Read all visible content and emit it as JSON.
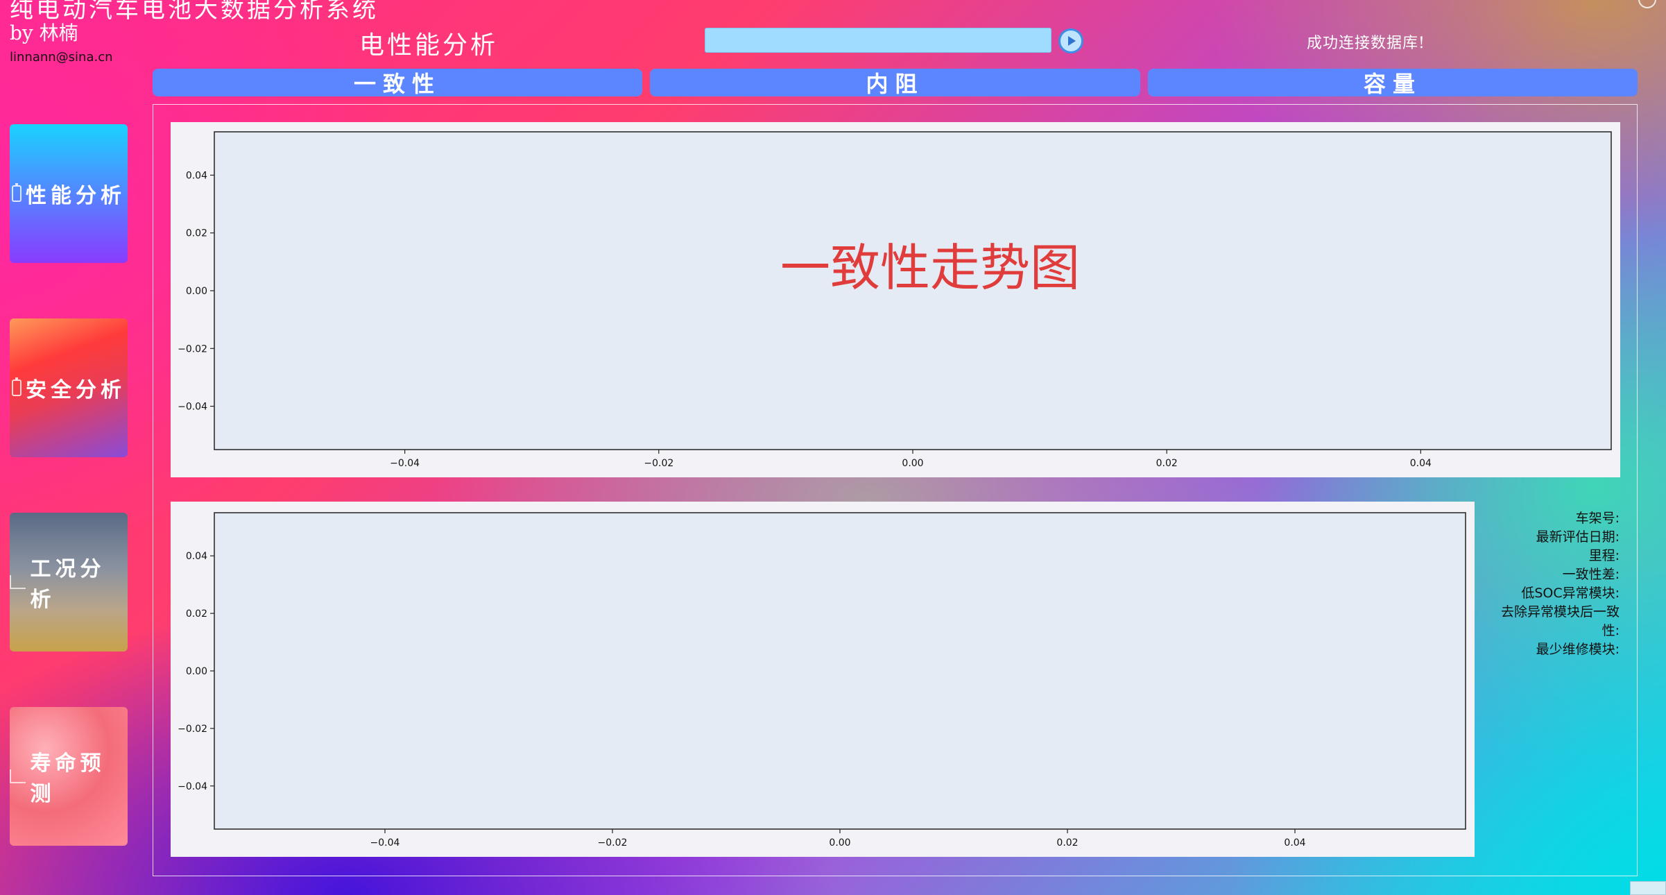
{
  "app": {
    "title": "纯电动汽车电池大数据分析系统",
    "author": "by 林楠",
    "email": "linnann@sina.cn"
  },
  "header": {
    "page_heading": "电性能分析",
    "search_value": "",
    "status": "成功连接数据库!"
  },
  "tabs": [
    {
      "label": "一致性"
    },
    {
      "label": "内阻"
    },
    {
      "label": "容量"
    }
  ],
  "sidebar": {
    "items": [
      {
        "label": "性能分析",
        "icon": "battery-icon"
      },
      {
        "label": "安全分析",
        "icon": "battery-icon"
      },
      {
        "label": "工况分析",
        "icon": "bar-chart-icon"
      },
      {
        "label": "寿命预测",
        "icon": "line-chart-icon"
      }
    ]
  },
  "chart_data": [
    {
      "type": "line",
      "annotation": "一致性走势图",
      "x": [],
      "series": [],
      "xlim": [
        -0.055,
        0.055
      ],
      "ylim": [
        -0.055,
        0.055
      ],
      "xticks": [
        "−0.04",
        "−0.02",
        "0.00",
        "0.02",
        "0.04"
      ],
      "yticks": [
        "0.04",
        "0.02",
        "0.00",
        "−0.02",
        "−0.04"
      ],
      "grid": false
    },
    {
      "type": "line",
      "x": [],
      "series": [],
      "xlim": [
        -0.055,
        0.055
      ],
      "ylim": [
        -0.055,
        0.055
      ],
      "xticks": [
        "−0.04",
        "−0.02",
        "0.00",
        "0.02",
        "0.04"
      ],
      "yticks": [
        "0.04",
        "0.02",
        "0.00",
        "−0.02",
        "−0.04"
      ],
      "grid": false
    }
  ],
  "info": {
    "labels": [
      "车架号:",
      "最新评估日期:",
      "里程:",
      "一致性差:",
      "低SOC异常模块:",
      "去除异常模块后一致性:",
      "最少维修模块:"
    ]
  },
  "colors": {
    "tab": "#5b86ff",
    "plot_area": "#e5ebf5",
    "annotation": "#e03c3c"
  }
}
